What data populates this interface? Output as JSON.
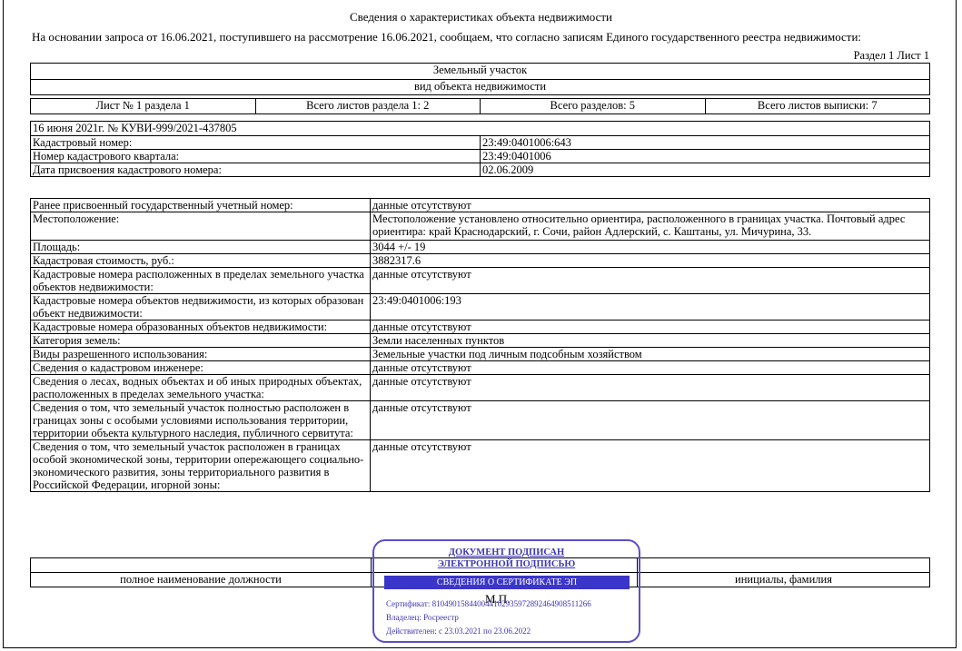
{
  "document": {
    "title": "Сведения о характеристиках объекта недвижимости",
    "intro": "На  основании запроса от 16.06.2021, поступившего на рассмотрение 16.06.2021, сообщаем, что согласно записям Единого государственного реестра недвижимости:",
    "sheet_ref": "Раздел 1 Лист 1"
  },
  "header": {
    "object_type": "Земельный участок",
    "object_kind_label": "вид объекта недвижимости"
  },
  "sheets": {
    "sheet": "Лист № 1 раздела 1",
    "total_sheets_section": "Всего листов раздела 1: 2",
    "total_sections": "Всего разделов: 5",
    "total_sheets_extract": "Всего листов выписки: 7"
  },
  "extract": {
    "date_number": "16 июня 2021г. № КУВИ-999/2021-437805",
    "rows": [
      {
        "label": "Кадастровый номер:",
        "value": "23:49:0401006:643"
      },
      {
        "label": "Номер кадастрового квартала:",
        "value": "23:49:0401006"
      },
      {
        "label": "Дата присвоения кадастрового номера:",
        "value": "02.06.2009"
      }
    ]
  },
  "characteristics": [
    {
      "label": "Ранее присвоенный государственный учетный номер:",
      "value": "данные отсутствуют"
    },
    {
      "label": "Местоположение:",
      "value": "Местоположение установлено относительно ориентира, расположенного в границах участка. Почтовый адрес ориентира: край Краснодарский, г. Сочи, район Адлерский, с. Каштаны, ул. Мичурина, 33."
    },
    {
      "label": "Площадь:",
      "value": "3044 +/- 19"
    },
    {
      "label": "Кадастровая стоимость, руб.:",
      "value": "3882317.6"
    },
    {
      "label": "Кадастровые номера расположенных в пределах земельного участка объектов недвижимости:",
      "value": "данные отсутствуют"
    },
    {
      "label": "Кадастровые номера объектов недвижимости, из которых образован объект недвижимости:",
      "value": "23:49:0401006:193"
    },
    {
      "label": "Кадастровые номера образованных объектов недвижимости:",
      "value": "данные отсутствуют"
    },
    {
      "label": "Категория земель:",
      "value": "Земли населенных пунктов"
    },
    {
      "label": "Виды разрешенного использования:",
      "value": "Земельные участки под личным подсобным хозяйством"
    },
    {
      "label": "Сведения о кадастровом инженере:",
      "value": "данные отсутствуют"
    },
    {
      "label": "Сведения о лесах, водных объектах и об иных природных объектах, расположенных в пределах земельного участка:",
      "value": "данные отсутствуют"
    },
    {
      "label": "Сведения о том, что земельный участок полностью расположен в границах зоны с особыми условиями использования территории, территории объекта культурного наследия, публичного сервитута:",
      "value": "данные отсутствуют"
    },
    {
      "label": "Сведения о том, что земельный участок расположен в границах особой экономической зоны, территории опережающего социально-экономического развития, зоны территориального развития в Российской Федерации, игорной зоны:",
      "value": "данные отсутствуют"
    }
  ],
  "signature": {
    "position_label": "полное наименование должности",
    "name_label": "инициалы, фамилия",
    "mp": "М.П."
  },
  "stamp": {
    "line1": "ДОКУМЕНТ ПОДПИСАН",
    "line2": "ЭЛЕКТРОННОЙ ПОДПИСЬЮ",
    "bar": "СВЕДЕНИЯ О СЕРТИФИКАТЕ ЭП",
    "certificate": "Сертификат: 810490158440044102935972892464908511266",
    "owner": "Владелец: Росреестр",
    "valid": "Действителен: с 23.03.2021 по 23.06.2022",
    "color": "#3b36c9"
  }
}
